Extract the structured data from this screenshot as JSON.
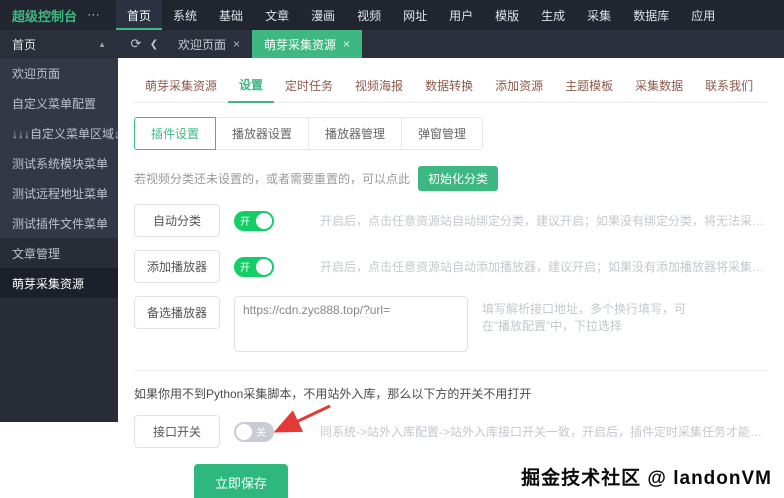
{
  "colors": {
    "accent": "#3eb883",
    "switch_on": "#13ce66",
    "switch_off": "#c8ccd4",
    "arrow": "#e53935"
  },
  "topbar": {
    "brand": "超级控制台",
    "more": "⋯",
    "items": [
      "首页",
      "系统",
      "基础",
      "文章",
      "漫画",
      "视频",
      "网址",
      "用户",
      "模版",
      "生成",
      "采集",
      "数据库",
      "应用"
    ]
  },
  "tabbar": {
    "refresh_icon": "⟳",
    "back_icon": "❮",
    "close": "×",
    "tabs": [
      {
        "label": "欢迎页面"
      },
      {
        "label": "萌芽采集资源"
      }
    ]
  },
  "sidebar": {
    "caret": "▲",
    "items": [
      "首页",
      "欢迎页面",
      "自定义菜单配置",
      "↓↓↓自定义菜单区域↓↓↓",
      "测试系统模块菜单",
      "测试远程地址菜单",
      "测试插件文件菜单",
      "文章管理",
      "萌芽采集资源"
    ]
  },
  "page_tabs": {
    "items": [
      "萌芽采集资源",
      "设置",
      "定时任务",
      "视频海报",
      "数据转换",
      "添加资源",
      "主题模板",
      "采集数据",
      "联系我们"
    ]
  },
  "sub_tabs": {
    "items": [
      "插件设置",
      "播放器设置",
      "播放器管理",
      "弹窗管理"
    ]
  },
  "notice": {
    "text": "若视频分类还未设置的，或者需要重置的，可以点此",
    "button": "初始化分类"
  },
  "form": {
    "auto_category": {
      "label": "自动分类",
      "switch": "开",
      "hint": "开启后，点击任意资源站自动绑定分类，建议开启；如果没有绑定分类，将无法采集到此分类的数据"
    },
    "add_player": {
      "label": "添加播放器",
      "switch": "开",
      "hint": "开启后，点击任意资源站自动添加播放器，建议开启；如果没有添加播放器将采集不到播放地址"
    },
    "backup_player": {
      "label": "备选播放器",
      "value": "https://cdn.zyc888.top/?url=",
      "hint": "填写解析接口地址，多个换行填写，可在“播放配置”中，下拉选择"
    },
    "warning": "如果你用不到Python采集脚本，不用站外入库，那么以下方的开关不用打开",
    "api_switch": {
      "label": "接口开关",
      "switch": "关",
      "hint": "同系统->站外入库配置->站外入库接口开关一致，开启后，插件定时采集任务才能采集数据发布入库"
    },
    "save": "立即保存"
  },
  "watermark": "掘金技术社区 @ landonVM"
}
